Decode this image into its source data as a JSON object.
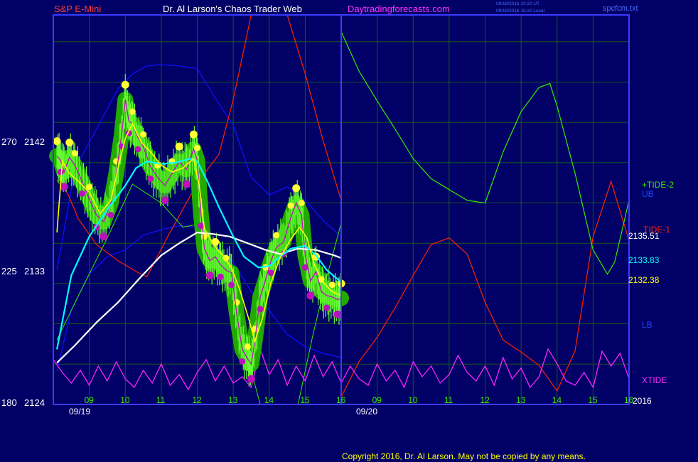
{
  "header": {
    "symbol": "S&P E-Mini",
    "author": "Dr. Al Larson's Chaos Trader Web",
    "site": "Daytradingforecasts.com",
    "stamp_ut": "09/19/2016 20:20 UT",
    "stamp_local": "09/19/2016 15:20 Local",
    "file": "spcfcm.txt"
  },
  "footer": {
    "copyright": "Copyright 2016, Dr. Al Larson. May not be copied by any means."
  },
  "chart_data": {
    "type": "line",
    "colors": {
      "background": "#000066",
      "grid": "#1a5a1a",
      "frame": "#3b3bff",
      "price_ribbon": "#22aa00",
      "price_high_dots": "#ffff33",
      "price_low_dots": "#bb11bb",
      "fast_ma": "#ffff00",
      "mid_ma": "#00ffff",
      "slow_ma": "#ffffff",
      "bands": "#1010ff",
      "tide2": "#33ee00",
      "tide1": "#ff2200",
      "xtide": "#ff22ff",
      "current_time": "#33ff33"
    },
    "y_axis": {
      "left_ticks": [
        {
          "scale": "270",
          "price": "2142",
          "value": 2142
        },
        {
          "scale": "225",
          "price": "2133",
          "value": 2133
        },
        {
          "scale": "180",
          "price": "2124",
          "value": 2124
        }
      ],
      "range": [
        2124,
        2153
      ]
    },
    "x_axis": {
      "hour_ticks": [
        "09",
        "10",
        "11",
        "12",
        "13",
        "14",
        "15",
        "16",
        "09",
        "10",
        "11",
        "12",
        "13",
        "14",
        "15",
        "16"
      ],
      "day_labels": [
        "09/19",
        "09/20"
      ],
      "year": "2016",
      "hour_range": [
        8,
        24
      ]
    },
    "right_labels": {
      "tide2": "+TIDE-2",
      "ub": "UB",
      "tide1": "TIDE-1",
      "price1": "2135.51",
      "price2": "2133.83",
      "price3": "2132.38",
      "lb": "LB",
      "xtide": "XTIDE"
    },
    "series": {
      "price": {
        "x": [
          8.1,
          8.2,
          8.3,
          8.45,
          8.6,
          8.8,
          9.0,
          9.2,
          9.4,
          9.6,
          9.75,
          9.9,
          10.0,
          10.1,
          10.2,
          10.35,
          10.5,
          10.7,
          10.9,
          11.1,
          11.3,
          11.5,
          11.7,
          11.9,
          12.0,
          12.1,
          12.2,
          12.35,
          12.5,
          12.65,
          12.8,
          12.95,
          13.1,
          13.25,
          13.4,
          13.5,
          13.6,
          13.75,
          13.9,
          14.05,
          14.2,
          14.4,
          14.6,
          14.75,
          14.9,
          15.0,
          15.15,
          15.3,
          15.45,
          15.6,
          15.75,
          15.9,
          16.0
        ],
        "y": [
          2142.5,
          2142.2,
          2141.3,
          2142.4,
          2141.8,
          2140.6,
          2139.3,
          2138.1,
          2137.6,
          2139.0,
          2141.2,
          2144.1,
          2146.7,
          2145.1,
          2144.9,
          2143.9,
          2143.2,
          2141.7,
          2140.9,
          2140.3,
          2141.2,
          2142.1,
          2141.5,
          2143.0,
          2142.2,
          2138.2,
          2135.6,
          2134.7,
          2135.0,
          2134.4,
          2134.0,
          2133.8,
          2130.7,
          2128.1,
          2127.4,
          2127.0,
          2128.7,
          2132.0,
          2133.3,
          2134.7,
          2135.7,
          2136.1,
          2137.9,
          2139.0,
          2138.1,
          2135.1,
          2133.2,
          2133.9,
          2132.4,
          2132.1,
          2132.0,
          2131.8,
          2131.9
        ]
      },
      "fast_ma": {
        "x": [
          8.1,
          8.25,
          8.45,
          8.7,
          9.0,
          9.3,
          9.6,
          9.8,
          10.0,
          10.2,
          10.45,
          10.7,
          11.0,
          11.3,
          11.6,
          11.9,
          12.05,
          12.2,
          12.45,
          12.7,
          12.95,
          13.2,
          13.45,
          13.6,
          13.8,
          14.05,
          14.3,
          14.6,
          14.85,
          15.05,
          15.25,
          15.5,
          15.75,
          16.0
        ],
        "y": [
          2136.8,
          2142.1,
          2141.2,
          2140.6,
          2139.8,
          2138.2,
          2139.2,
          2141.6,
          2143.8,
          2144.9,
          2143.5,
          2142.8,
          2141.8,
          2141.3,
          2141.6,
          2142.3,
          2140.4,
          2137.1,
          2135.9,
          2135.1,
          2134.2,
          2132.4,
          2130.2,
          2128.7,
          2130.3,
          2133.1,
          2134.9,
          2136.3,
          2137.2,
          2136.4,
          2134.4,
          2133.1,
          2132.4,
          2132.1
        ]
      },
      "mid_ma": {
        "x": [
          8.1,
          8.5,
          9.0,
          9.5,
          10.0,
          10.3,
          10.6,
          11.0,
          11.4,
          11.8,
          12.0,
          12.3,
          12.6,
          13.0,
          13.3,
          13.7,
          14.0,
          14.3,
          14.6,
          15.0,
          15.3,
          15.6,
          16.0
        ],
        "y": [
          2128.1,
          2133.6,
          2136.5,
          2138.5,
          2140.3,
          2141.6,
          2142.1,
          2141.9,
          2142.0,
          2142.3,
          2142.1,
          2140.5,
          2138.7,
          2136.5,
          2135.0,
          2134.2,
          2134.3,
          2135.0,
          2135.6,
          2135.8,
          2135.1,
          2134.0,
          2133.1
        ]
      },
      "slow_ma": {
        "x": [
          8.1,
          8.6,
          9.2,
          9.8,
          10.4,
          11.0,
          11.5,
          12.0,
          12.4,
          12.9,
          13.4,
          13.9,
          14.3,
          14.8,
          15.3,
          15.8,
          16.0
        ],
        "y": [
          2127.1,
          2128.4,
          2130.1,
          2131.6,
          2133.4,
          2135.1,
          2136.0,
          2136.8,
          2136.7,
          2136.5,
          2136.0,
          2135.5,
          2135.2,
          2135.6,
          2135.5,
          2135.1,
          2134.9
        ]
      },
      "upper_band": {
        "x": [
          8.1,
          8.6,
          9.2,
          9.8,
          10.2,
          10.6,
          11.0,
          11.5,
          12.0,
          12.5,
          13.0,
          13.5,
          14.0,
          14.5,
          15.0,
          15.5,
          16.0
        ],
        "y": [
          2134.0,
          2141.5,
          2144.5,
          2147.5,
          2148.6,
          2149.2,
          2149.3,
          2149.2,
          2149.0,
          2146.8,
          2144.8,
          2140.9,
          2139.6,
          2140.2,
          2139.2,
          2137.7,
          2136.5
        ]
      },
      "lower_band": {
        "x": [
          8.1,
          8.5,
          9.0,
          9.5,
          10.0,
          10.5,
          11.0,
          11.5,
          12.0,
          12.5,
          13.0,
          13.5,
          14.0,
          14.5,
          15.0,
          15.5,
          16.0
        ],
        "y": [
          2126.5,
          2131.0,
          2133.7,
          2135.0,
          2135.5,
          2136.6,
          2137.0,
          2137.3,
          2137.2,
          2135.8,
          2134.6,
          2132.4,
          2131.0,
          2129.2,
          2128.3,
          2127.8,
          2127.5
        ]
      },
      "green_wave": {
        "x": [
          8.1,
          8.7,
          9.5,
          10.2,
          11.0,
          11.6,
          12.0,
          12.5,
          13.0,
          13.4,
          13.75,
          14.0,
          14.4,
          14.8,
          15.2,
          15.6,
          15.8,
          16.0
        ],
        "y": [
          2128.8,
          2132.1,
          2136.4,
          2140.4,
          2139.0,
          2137.2,
          2137.4,
          2136.0,
          2131.0,
          2127.5,
          2123.4,
          2123.5,
          2123.5,
          2123.9,
          2129.0,
          2133.5,
          2135.5,
          2137.5
        ]
      },
      "tide1": {
        "x": [
          8.1,
          8.4,
          8.7,
          9.2,
          9.8,
          10.3,
          10.6,
          11.2,
          11.8,
          12.2,
          12.6,
          13.0,
          13.5,
          13.8,
          14.1,
          14.5,
          15.0,
          15.5,
          16.0,
          16.01,
          16.5,
          17.0,
          17.5,
          18.0,
          18.5,
          19.0,
          19.5,
          20.0,
          20.5,
          21.0,
          21.5,
          22.0,
          22.5,
          23.0,
          23.5,
          24.0
        ],
        "y": [
          2140.7,
          2139.7,
          2137.8,
          2135.9,
          2134.7,
          2133.9,
          2133.5,
          2136.6,
          2139.5,
          2141.2,
          2142.6,
          2146.7,
          2155.0,
          2158.0,
          2157.0,
          2154.0,
          2148.6,
          2143.6,
          2139.2,
          2124.6,
          2127.2,
          2129.0,
          2131.2,
          2133.6,
          2135.9,
          2136.4,
          2135.2,
          2131.6,
          2128.8,
          2127.9,
          2126.9,
          2125.0,
          2128.0,
          2136.5,
          2140.6,
          2136.2
        ]
      },
      "tide2": {
        "x": [
          16.0,
          16.01,
          16.5,
          17.0,
          17.5,
          18.0,
          18.5,
          19.0,
          19.5,
          20.0,
          20.5,
          21.0,
          21.5,
          21.8,
          22.0,
          22.5,
          23.0,
          23.4,
          23.6,
          24.0
        ],
        "y": [
          2140.0,
          2151.7,
          2148.8,
          2146.6,
          2144.5,
          2142.3,
          2140.8,
          2140.0,
          2139.2,
          2139.0,
          2142.8,
          2145.8,
          2147.6,
          2147.9,
          2146.2,
          2141.2,
          2135.5,
          2133.7,
          2134.6,
          2139.2
        ]
      },
      "xtide_wave": {
        "x": [
          8.0,
          8.25,
          8.5,
          8.75,
          9.0,
          9.25,
          9.5,
          9.75,
          10.0,
          10.25,
          10.5,
          10.75,
          11.0,
          11.25,
          11.5,
          11.75,
          12.0,
          12.25,
          12.5,
          12.75,
          13.0,
          13.25,
          13.5,
          13.75,
          14.0,
          14.25,
          14.5,
          14.75,
          15.0,
          15.25,
          15.5,
          15.75,
          16.0,
          16.25,
          16.5,
          16.75,
          17.0,
          17.25,
          17.5,
          17.75,
          18.0,
          18.25,
          18.5,
          18.75,
          19.0,
          19.25,
          19.5,
          19.75,
          20.0,
          20.25,
          20.5,
          20.75,
          21.0,
          21.25,
          21.5,
          21.75,
          22.0,
          22.25,
          22.5,
          22.75,
          23.0,
          23.25,
          23.5,
          23.75,
          24.0
        ],
        "level": [
          0.7,
          0.4,
          0.15,
          0.45,
          0.1,
          0.55,
          0.2,
          0.65,
          0.25,
          0.05,
          0.45,
          0.15,
          0.6,
          0.1,
          0.35,
          0.0,
          0.4,
          0.7,
          0.2,
          0.55,
          0.15,
          0.3,
          0.05,
          0.95,
          0.35,
          0.7,
          0.1,
          0.55,
          0.2,
          0.8,
          0.3,
          0.65,
          0.15,
          0.55,
          0.25,
          0.1,
          0.6,
          0.2,
          0.45,
          0.05,
          0.65,
          0.3,
          0.55,
          0.15,
          0.35,
          0.8,
          0.4,
          0.2,
          0.55,
          0.1,
          0.75,
          0.25,
          0.5,
          0.05,
          0.3,
          0.95,
          0.6,
          0.2,
          0.1,
          0.4,
          0.05,
          0.9,
          0.55,
          0.85,
          0.25
        ]
      }
    }
  }
}
